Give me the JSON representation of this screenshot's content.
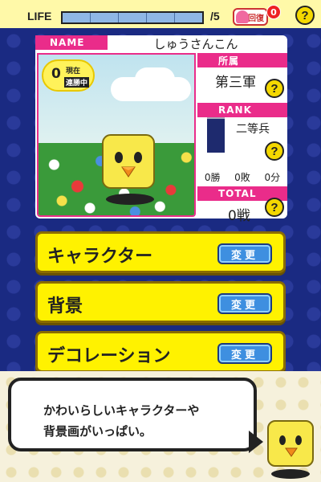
{
  "header": {
    "life_label": "LIFE",
    "life_max": "/5",
    "life_segments": 5,
    "recover_label": "回復",
    "recover_count": "0",
    "help": "?"
  },
  "profile": {
    "name_tag": "NAME",
    "name": "しゅうさんこん",
    "win_count": "0",
    "win_now": "現在",
    "win_label": "連勝中",
    "affiliation_tag": "所属",
    "affiliation": "第三軍",
    "rank_tag": "RANK",
    "rank": "二等兵",
    "wins": "0勝",
    "losses": "0敗",
    "draws": "0分",
    "total_tag": "TOTAL",
    "total": "0戦",
    "help": "?"
  },
  "menu": [
    {
      "label": "キャラクター",
      "button": "変更"
    },
    {
      "label": "背景",
      "button": "変更"
    },
    {
      "label": "デコレーション",
      "button": "変更"
    }
  ],
  "tip": {
    "line1": "かわいらしいキャラクターや",
    "line2": "背景画がいっぱい。"
  },
  "colors": {
    "accent_pink": "#ea2c8a",
    "button_yellow": "#fff200",
    "button_blue": "#3e8fe0",
    "background_navy": "#1a2a82"
  }
}
